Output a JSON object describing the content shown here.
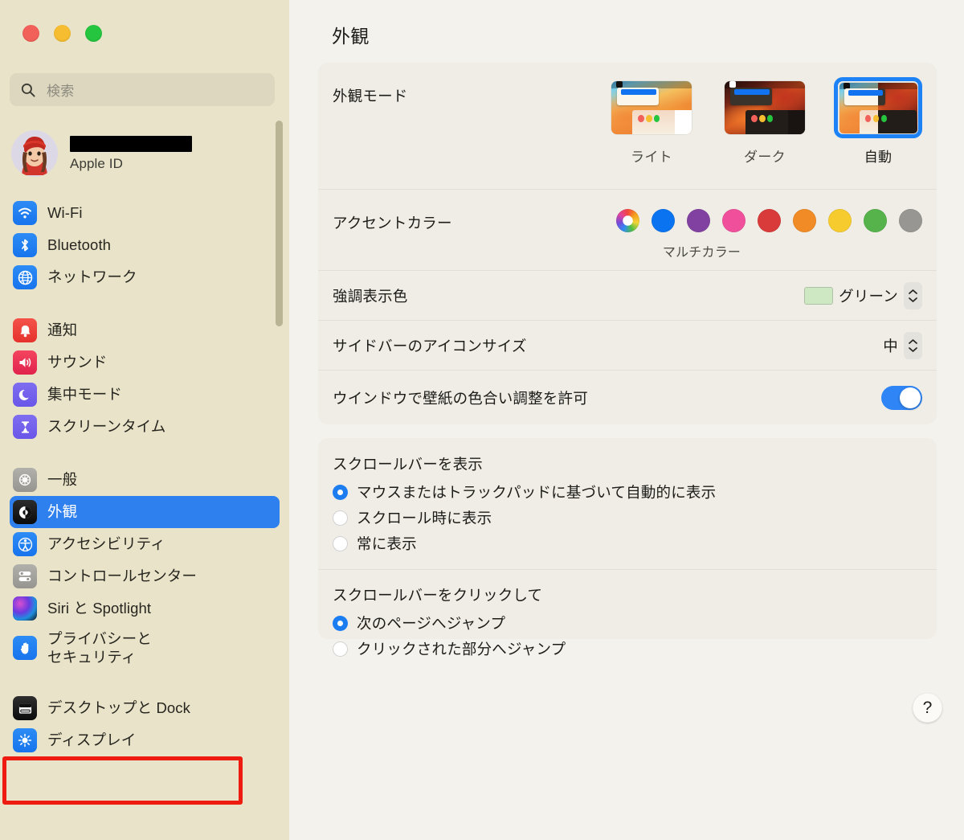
{
  "window": {
    "traffic_lights": [
      "close",
      "minimize",
      "zoom"
    ]
  },
  "sidebar": {
    "search": {
      "placeholder": "検索",
      "value": ""
    },
    "account": {
      "name_redacted": true,
      "subtitle": "Apple ID"
    },
    "groups": [
      {
        "items": [
          {
            "label": "Wi-Fi",
            "icon": "wifi-icon",
            "selected": false
          },
          {
            "label": "Bluetooth",
            "icon": "bluetooth-icon",
            "selected": false
          },
          {
            "label": "ネットワーク",
            "icon": "network-icon",
            "selected": false
          }
        ]
      },
      {
        "items": [
          {
            "label": "通知",
            "icon": "bell-icon",
            "selected": false
          },
          {
            "label": "サウンド",
            "icon": "speaker-icon",
            "selected": false
          },
          {
            "label": "集中モード",
            "icon": "moon-icon",
            "selected": false
          },
          {
            "label": "スクリーンタイム",
            "icon": "hourglass-icon",
            "selected": false
          }
        ]
      },
      {
        "items": [
          {
            "label": "一般",
            "icon": "gear-icon",
            "selected": false
          },
          {
            "label": "外観",
            "icon": "appearance-icon",
            "selected": true
          },
          {
            "label": "アクセシビリティ",
            "icon": "accessibility-icon",
            "selected": false
          },
          {
            "label": "コントロールセンター",
            "icon": "control-center-icon",
            "selected": false
          },
          {
            "label": "Siri と Spotlight",
            "icon": "siri-icon",
            "selected": false
          },
          {
            "label": "プライバシーと\nセキュリティ",
            "icon": "hand-privacy-icon",
            "selected": false
          }
        ]
      },
      {
        "items": [
          {
            "label": "デスクトップと Dock",
            "icon": "desktop-dock-icon",
            "selected": false,
            "annotated": true
          },
          {
            "label": "ディスプレイ",
            "icon": "display-icon",
            "selected": false
          }
        ]
      }
    ],
    "annotation": {
      "color": "#ee1b11",
      "target": "デスクトップと Dock"
    }
  },
  "main": {
    "title": "外観",
    "appearance_mode": {
      "label": "外観モード",
      "options": [
        {
          "label": "ライト",
          "value": "light",
          "selected": false
        },
        {
          "label": "ダーク",
          "value": "dark",
          "selected": false
        },
        {
          "label": "自動",
          "value": "auto",
          "selected": true
        }
      ]
    },
    "accent_color": {
      "label": "アクセントカラー",
      "caption": "マルチカラー",
      "swatches": [
        {
          "name": "マルチカラー",
          "color": "multicolor",
          "selected": true
        },
        {
          "name": "ブルー",
          "color": "#0a74f0"
        },
        {
          "name": "パープル",
          "color": "#8141a0"
        },
        {
          "name": "ピンク",
          "color": "#f0509b"
        },
        {
          "name": "レッド",
          "color": "#d93b3b"
        },
        {
          "name": "オレンジ",
          "color": "#f08b25"
        },
        {
          "name": "イエロー",
          "color": "#f5cb2e"
        },
        {
          "name": "グリーン",
          "color": "#56b martinez"
        },
        {
          "name": "グラファイト",
          "color": "#989692"
        }
      ]
    },
    "highlight_color": {
      "label": "強調表示色",
      "value": "グリーン",
      "chip_color": "#cfe8c4"
    },
    "sidebar_icon_size": {
      "label": "サイドバーのアイコンサイズ",
      "value": "中"
    },
    "wallpaper_tinting": {
      "label": "ウインドウで壁紙の色合い調整を許可",
      "enabled": true
    },
    "show_scrollbars": {
      "heading": "スクロールバーを表示",
      "options": [
        {
          "label": "マウスまたはトラックパッドに基づいて自動的に表示",
          "selected": true
        },
        {
          "label": "スクロール時に表示",
          "selected": false
        },
        {
          "label": "常に表示",
          "selected": false
        }
      ]
    },
    "click_scrollbar": {
      "heading": "スクロールバーをクリックして",
      "options": [
        {
          "label": "次のページへジャンプ",
          "selected": true
        },
        {
          "label": "クリックされた部分へジャンプ",
          "selected": false
        }
      ]
    },
    "help_button": {
      "label": "?"
    }
  }
}
